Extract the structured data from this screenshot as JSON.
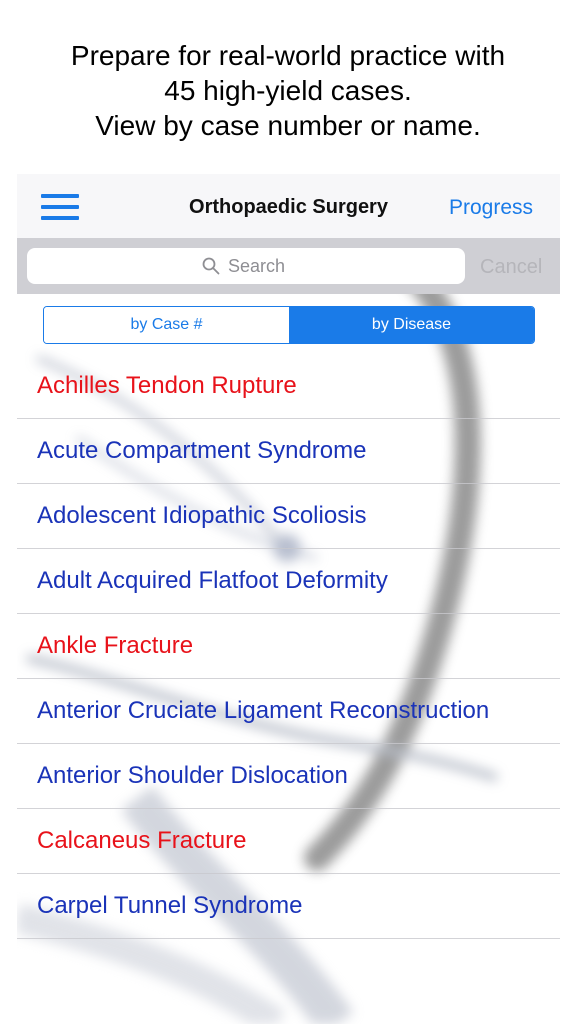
{
  "promo": {
    "line1": "Prepare for real-world practice with",
    "line2": "45 high-yield cases.",
    "line3": "View by case number or name."
  },
  "navbar": {
    "title": "Orthopaedic Surgery",
    "progress_label": "Progress",
    "menu_icon": "hamburger-menu-icon"
  },
  "search": {
    "placeholder": "Search",
    "value": "",
    "cancel_label": "Cancel",
    "icon": "search-icon"
  },
  "segments": {
    "by_case": "by Case #",
    "by_disease": "by Disease",
    "selected": "by Disease"
  },
  "colors": {
    "accent": "#1a7be8",
    "completed": "#e8121a",
    "incomplete": "#1a33b8"
  },
  "cases": [
    {
      "name": "Achilles Tendon Rupture",
      "status": "red"
    },
    {
      "name": "Acute Compartment Syndrome",
      "status": "blue"
    },
    {
      "name": "Adolescent Idiopathic Scoliosis",
      "status": "blue"
    },
    {
      "name": "Adult Acquired Flatfoot Deformity",
      "status": "blue"
    },
    {
      "name": "Ankle Fracture",
      "status": "red"
    },
    {
      "name": "Anterior Cruciate Ligament Reconstruction",
      "status": "blue"
    },
    {
      "name": "Anterior Shoulder Dislocation",
      "status": "blue"
    },
    {
      "name": "Calcaneus Fracture",
      "status": "red"
    },
    {
      "name": "Carpel Tunnel Syndrome",
      "status": "blue"
    }
  ]
}
